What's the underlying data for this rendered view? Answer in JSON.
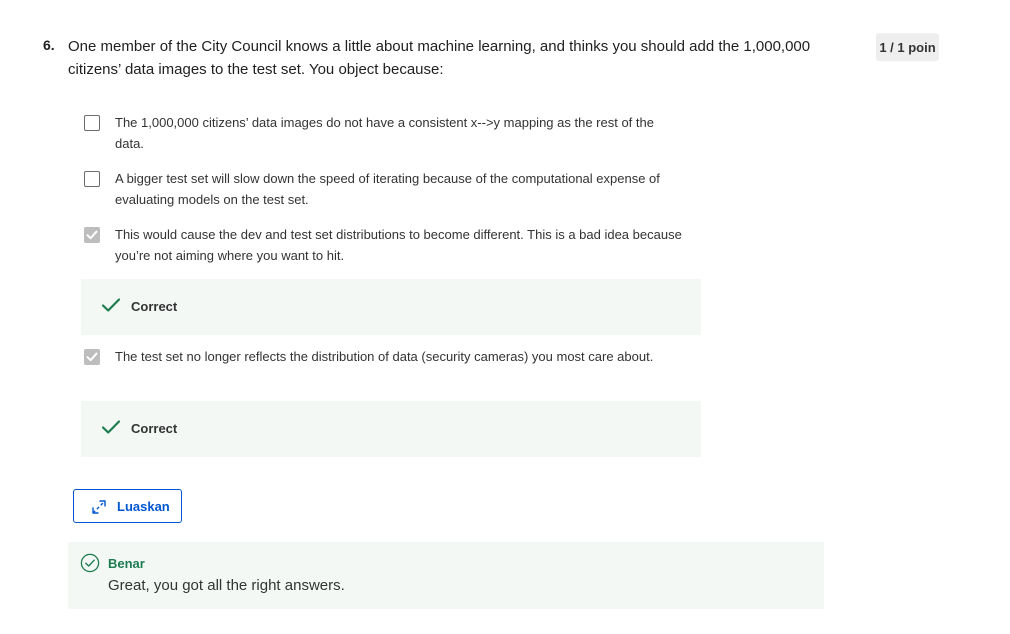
{
  "question": {
    "number": "6.",
    "text": "One member of the City Council knows a little about machine learning, and thinks you should add the 1,000,000 citizens’ data images to the test set. You object because:",
    "points": "1 / 1 poin"
  },
  "options": [
    {
      "text": "The 1,000,000 citizens’ data images do not have a consistent x-->y mapping as the rest of the data.",
      "checked": false
    },
    {
      "text": "A bigger test set will slow down the speed of iterating because of the computational expense of evaluating models on the test set.",
      "checked": false
    },
    {
      "text": "This would cause the dev and test set distributions to become different. This is a bad idea because you’re not aiming where you want to hit.",
      "checked": true,
      "feedback": "Correct"
    },
    {
      "text": "The test set no longer reflects the distribution of data (security cameras) you most care about.",
      "checked": true,
      "feedback": "Correct"
    }
  ],
  "expand_button": {
    "label": "Luaskan",
    "icon": "expand-arrows-icon"
  },
  "result": {
    "title": "Benar",
    "message": "Great, you got all the right answers.",
    "icon": "check-circle-icon"
  },
  "colors": {
    "accent_blue": "#0056d2",
    "success_green": "#1e7c4f",
    "feedback_background": "#f3f8f5",
    "checked_box": "#bdbdbd"
  }
}
